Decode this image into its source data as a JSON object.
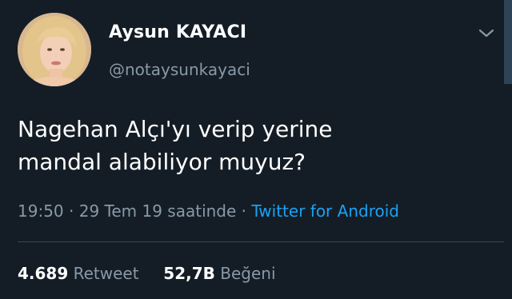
{
  "author": {
    "display_name": "Aysun KAYACI",
    "handle": "@notaysunkayaci"
  },
  "icons": {
    "menu": "chevron-down-icon"
  },
  "tweet": {
    "lines": [
      "Nagehan Alçı'yı verip yerine",
      "mandal alabiliyor muyuz?"
    ]
  },
  "meta": {
    "time": "19:50",
    "separator": "·",
    "date": "29 Tem 19 saatinde",
    "source": "Twitter for Android"
  },
  "stats": {
    "retweet_count": "4.689",
    "retweet_label": "Retweet",
    "like_count": "52,7B",
    "like_label": "Beğeni"
  },
  "colors": {
    "background": "#141d26",
    "secondary_text": "#8899a6",
    "link": "#1da1f2",
    "divider": "#38444d"
  }
}
